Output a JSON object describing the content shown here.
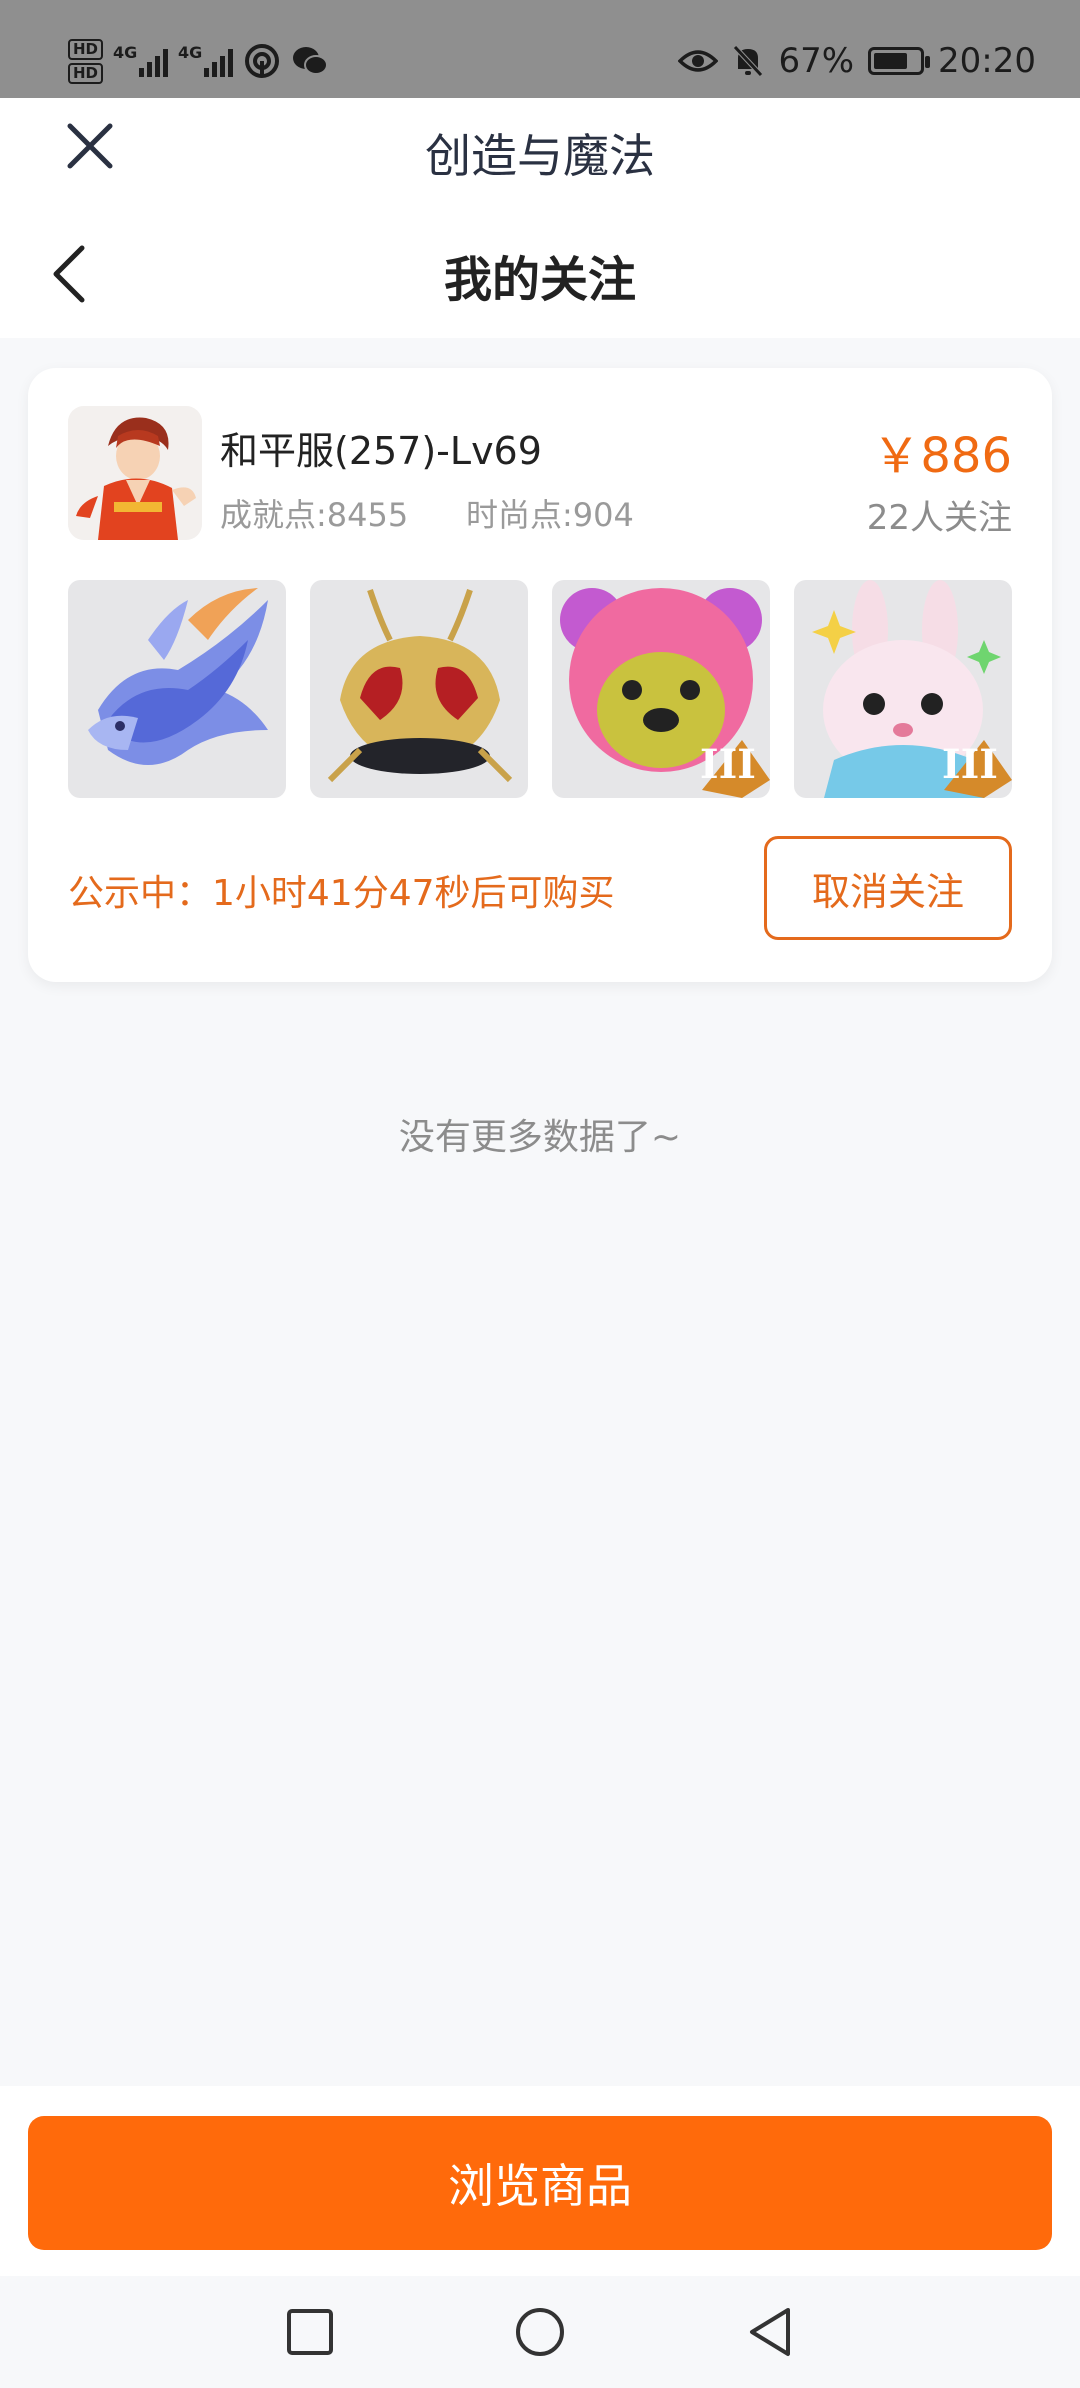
{
  "status_bar": {
    "hd1": "HD",
    "hd2": "HD",
    "net1": "4G",
    "net2": "4G",
    "battery_percent": "67%",
    "time": "20:20"
  },
  "header": {
    "app_title": "创造与魔法",
    "page_title": "我的关注"
  },
  "card": {
    "server_name": "和平服(257)-Lv69",
    "achievement": "成就点:8455",
    "fashion": "时尚点:904",
    "price": "￥886",
    "followers": "22人关注",
    "items": [
      {
        "name": "dragon-item"
      },
      {
        "name": "golden-helmet-item"
      },
      {
        "name": "pink-bear-item",
        "badge": "III"
      },
      {
        "name": "rabbit-item",
        "badge": "III"
      }
    ],
    "notice": "公示中：1小时41分47秒后可购买",
    "unfollow_label": "取消关注"
  },
  "empty_text": "没有更多数据了~",
  "browse_label": "浏览商品",
  "colors": {
    "accent": "#ff6a0b",
    "accent_text": "#e46a1c",
    "background": "#f7f8fa"
  }
}
